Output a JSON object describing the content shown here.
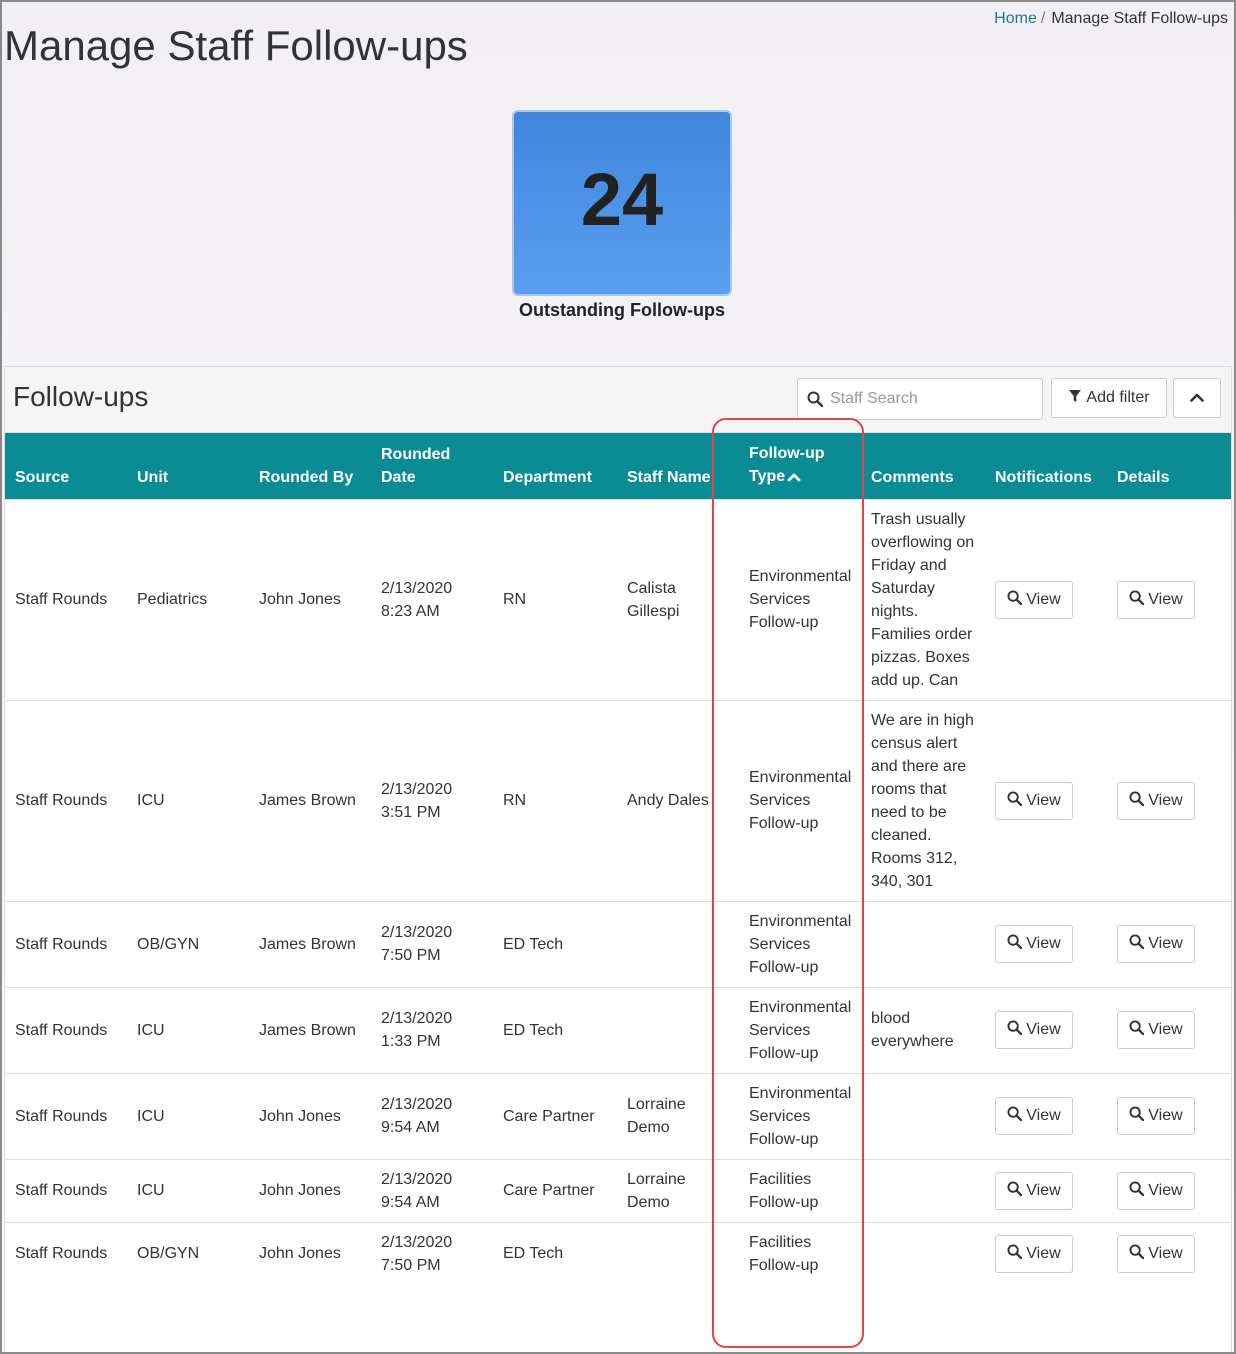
{
  "breadcrumb": {
    "home": "Home",
    "current": "Manage Staff Follow-ups"
  },
  "page_title": "Manage Staff Follow-ups",
  "kpi": {
    "value": "24",
    "label": "Outstanding Follow-ups",
    "color": "#4a90e2"
  },
  "panel": {
    "title": "Follow-ups",
    "search_placeholder": "Staff Search",
    "add_filter_label": "Add filter"
  },
  "colors": {
    "header_bg": "#0b8c94",
    "link": "#1d7a8c",
    "highlight": "#e0454a"
  },
  "table": {
    "columns": [
      {
        "label": "Source"
      },
      {
        "label": "Unit"
      },
      {
        "label": "Rounded By"
      },
      {
        "label": "Rounded Date"
      },
      {
        "label": "Department"
      },
      {
        "label": "Staff Name"
      },
      {
        "label": "Follow-up Type",
        "sort": "ascending"
      },
      {
        "label": "Comments"
      },
      {
        "label": "Notifications"
      },
      {
        "label": "Details"
      }
    ],
    "view_label": "View",
    "rows": [
      {
        "source": "Staff Rounds",
        "unit": "Pediatrics",
        "rounded_by": "John Jones",
        "date": "2/13/2020",
        "time": "8:23 AM",
        "department": "RN",
        "staff_name": "Calista Gillespi",
        "type": "Environmental Services Follow-up",
        "comments": "Trash usually overflowing on Friday and Saturday nights. Families order pizzas. Boxes add up. Can"
      },
      {
        "source": "Staff Rounds",
        "unit": "ICU",
        "rounded_by": "James Brown",
        "date": "2/13/2020",
        "time": "3:51 PM",
        "department": "RN",
        "staff_name": "Andy Dales",
        "type": "Environmental Services Follow-up",
        "comments": "We are in high census alert and there are rooms that need to be cleaned. Rooms 312, 340, 301"
      },
      {
        "source": "Staff Rounds",
        "unit": "OB/GYN",
        "rounded_by": "James Brown",
        "date": "2/13/2020",
        "time": "7:50 PM",
        "department": "ED Tech",
        "staff_name": "",
        "type": "Environmental Services Follow-up",
        "comments": ""
      },
      {
        "source": "Staff Rounds",
        "unit": "ICU",
        "rounded_by": "James Brown",
        "date": "2/13/2020",
        "time": "1:33 PM",
        "department": "ED Tech",
        "staff_name": "",
        "type": "Environmental Services Follow-up",
        "comments": "blood everywhere"
      },
      {
        "source": "Staff Rounds",
        "unit": "ICU",
        "rounded_by": "John Jones",
        "date": "2/13/2020",
        "time": "9:54 AM",
        "department": "Care Partner",
        "staff_name": "Lorraine Demo",
        "type": "Environmental Services Follow-up",
        "comments": ""
      },
      {
        "source": "Staff Rounds",
        "unit": "ICU",
        "rounded_by": "John Jones",
        "date": "2/13/2020",
        "time": "9:54 AM",
        "department": "Care Partner",
        "staff_name": "Lorraine Demo",
        "type": "Facilities Follow-up",
        "comments": ""
      },
      {
        "source": "Staff Rounds",
        "unit": "OB/GYN",
        "rounded_by": "John Jones",
        "date": "2/13/2020",
        "time": "7:50 PM",
        "department": "ED Tech",
        "staff_name": "",
        "type": "Facilities Follow-up",
        "comments": ""
      }
    ]
  }
}
